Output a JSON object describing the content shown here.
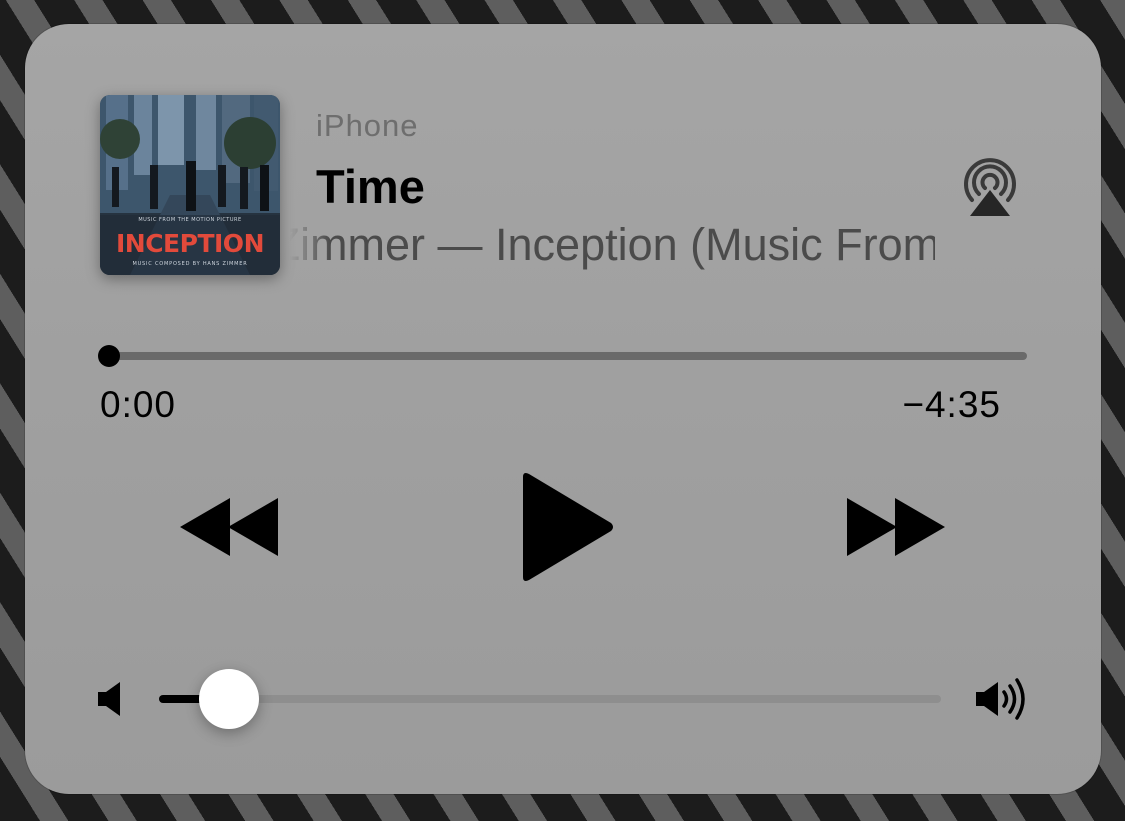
{
  "now_playing": {
    "device": "iPhone",
    "title": "Time",
    "subtitle": "Hans Zimmer — Inception (Music From the Motion Picture)",
    "artwork": {
      "top_text": "MUSIC FROM THE MOTION PICTURE",
      "title_text": "INCEPTION",
      "credit_text": "MUSIC COMPOSED BY HANS ZIMMER",
      "title_color": "#e24a3b"
    }
  },
  "progress": {
    "elapsed": "0:00",
    "remaining": "−4:35",
    "fraction": 0
  },
  "controls": {
    "rewind_icon": "rewind-icon",
    "play_icon": "play-icon",
    "forward_icon": "fast-forward-icon",
    "airplay_icon": "airplay-icon"
  },
  "volume": {
    "fraction": 0.09,
    "low_icon": "volume-low-icon",
    "high_icon": "volume-high-icon"
  },
  "colors": {
    "panel": "#a2a2a2",
    "control": "#000000",
    "secondary_text": "#6e6e6e"
  }
}
